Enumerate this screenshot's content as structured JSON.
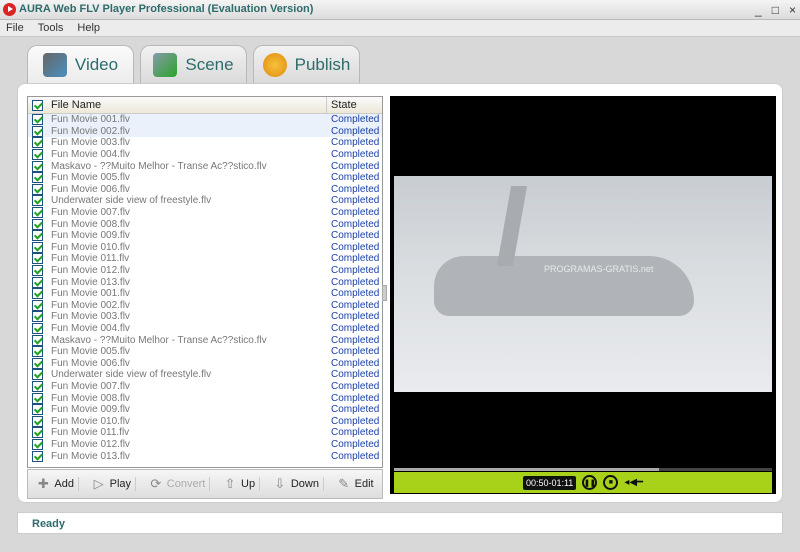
{
  "window": {
    "title": "AURA Web FLV Player Professional (Evaluation Version)",
    "controls": [
      "_",
      "□",
      "×"
    ]
  },
  "menu": [
    "File",
    "Tools",
    "Help"
  ],
  "tabs": [
    {
      "label": "Video",
      "icon": "film-reel-icon",
      "active": true
    },
    {
      "label": "Scene",
      "icon": "scene-check-icon"
    },
    {
      "label": "Publish",
      "icon": "publish-arrow-icon"
    }
  ],
  "list": {
    "headers": {
      "name": "File Name",
      "state": "State"
    },
    "rows": [
      [
        "Fun Movie 001.flv",
        "Completed"
      ],
      [
        "Fun Movie 002.flv",
        "Completed"
      ],
      [
        "Fun Movie 003.flv",
        "Completed"
      ],
      [
        "Fun Movie 004.flv",
        "Completed"
      ],
      [
        "Maskavo - ??Muito Melhor - Transe Ac??stico.flv",
        "Completed"
      ],
      [
        "Fun Movie 005.flv",
        "Completed"
      ],
      [
        "Fun Movie 006.flv",
        "Completed"
      ],
      [
        "Underwater side view of freestyle.flv",
        "Completed"
      ],
      [
        "Fun Movie 007.flv",
        "Completed"
      ],
      [
        "Fun Movie 008.flv",
        "Completed"
      ],
      [
        "Fun Movie 009.flv",
        "Completed"
      ],
      [
        "Fun Movie 010.flv",
        "Completed"
      ],
      [
        "Fun Movie 011.flv",
        "Completed"
      ],
      [
        "Fun Movie 012.flv",
        "Completed"
      ],
      [
        "Fun Movie 013.flv",
        "Completed"
      ],
      [
        "Fun Movie 001.flv",
        "Completed"
      ],
      [
        "Fun Movie 002.flv",
        "Completed"
      ],
      [
        "Fun Movie 003.flv",
        "Completed"
      ],
      [
        "Fun Movie 004.flv",
        "Completed"
      ],
      [
        "Maskavo - ??Muito Melhor - Transe Ac??stico.flv",
        "Completed"
      ],
      [
        "Fun Movie 005.flv",
        "Completed"
      ],
      [
        "Fun Movie 006.flv",
        "Completed"
      ],
      [
        "Underwater side view of freestyle.flv",
        "Completed"
      ],
      [
        "Fun Movie 007.flv",
        "Completed"
      ],
      [
        "Fun Movie 008.flv",
        "Completed"
      ],
      [
        "Fun Movie 009.flv",
        "Completed"
      ],
      [
        "Fun Movie 010.flv",
        "Completed"
      ],
      [
        "Fun Movie 011.flv",
        "Completed"
      ],
      [
        "Fun Movie 012.flv",
        "Completed"
      ],
      [
        "Fun Movie 013.flv",
        "Completed"
      ]
    ]
  },
  "toolbar": [
    {
      "label": "Add",
      "icon": "✚",
      "enabled": true
    },
    {
      "label": "Play",
      "icon": "▷",
      "enabled": true
    },
    {
      "label": "Convert",
      "icon": "⟳",
      "enabled": false
    },
    {
      "label": "Up",
      "icon": "⇧",
      "enabled": true
    },
    {
      "label": "Down",
      "icon": "⇩",
      "enabled": true
    },
    {
      "label": "Edit",
      "icon": "✎",
      "enabled": true
    }
  ],
  "player": {
    "time": "00:50-01:11",
    "progress": 0.7,
    "watermark": "PROGRAMAS-GRATIS.net",
    "accent": "#a8d21a"
  },
  "status": "Ready"
}
